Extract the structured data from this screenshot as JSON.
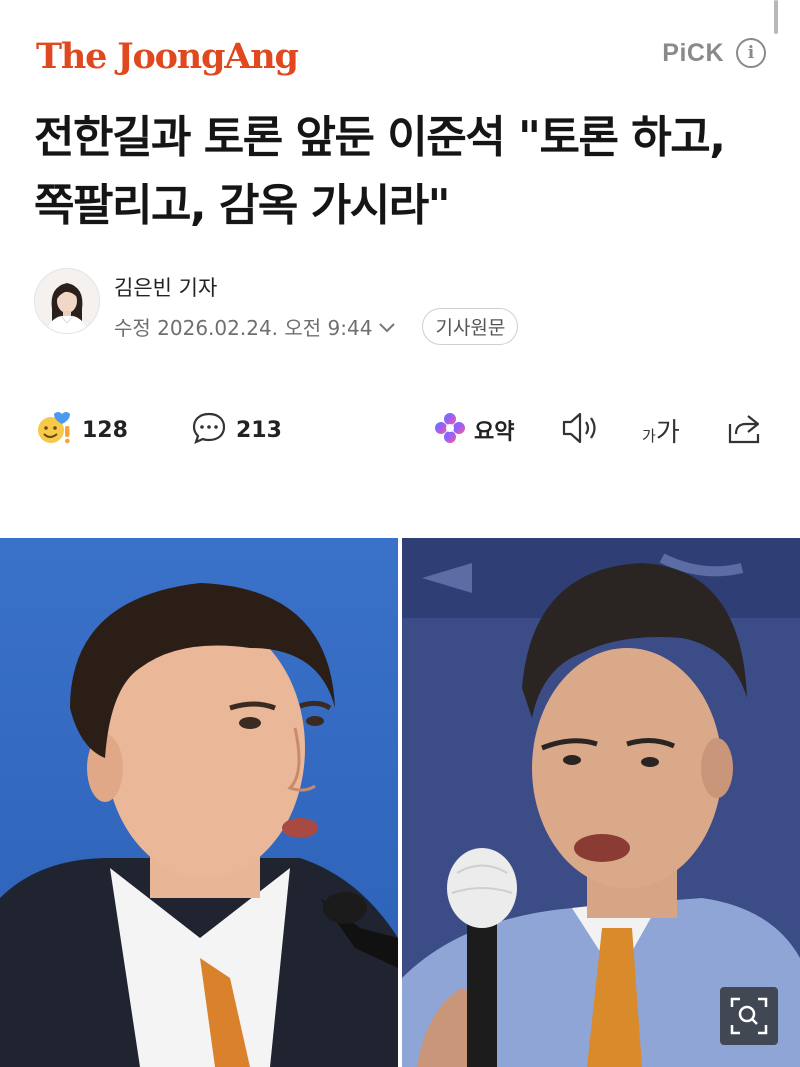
{
  "header": {
    "logo_text": "The JoongAng",
    "pick_label": "PiCK",
    "info_icon": "info-icon",
    "brand_color": "#e0481f"
  },
  "headline": "전한길과 토론 앞둔 이준석 \"토론 하고, 쪽팔리고, 감옥 가시라\"",
  "author": {
    "name": "김은빈 기자",
    "modified": "수정 2026.02.24. 오전 9:44",
    "original_button": "기사원문"
  },
  "actions": {
    "reaction_icon": "emoji-reaction-icon",
    "reaction_count": "128",
    "comment_icon": "comment-icon",
    "comment_count": "213",
    "summary_icon": "ai-summary-icon",
    "summary_label": "요약",
    "tts_icon": "speaker-icon",
    "font_size_small": "가",
    "font_size_large": "가",
    "share_icon": "share-icon"
  },
  "photo": {
    "zoom_icon": "zoom-search-icon"
  }
}
